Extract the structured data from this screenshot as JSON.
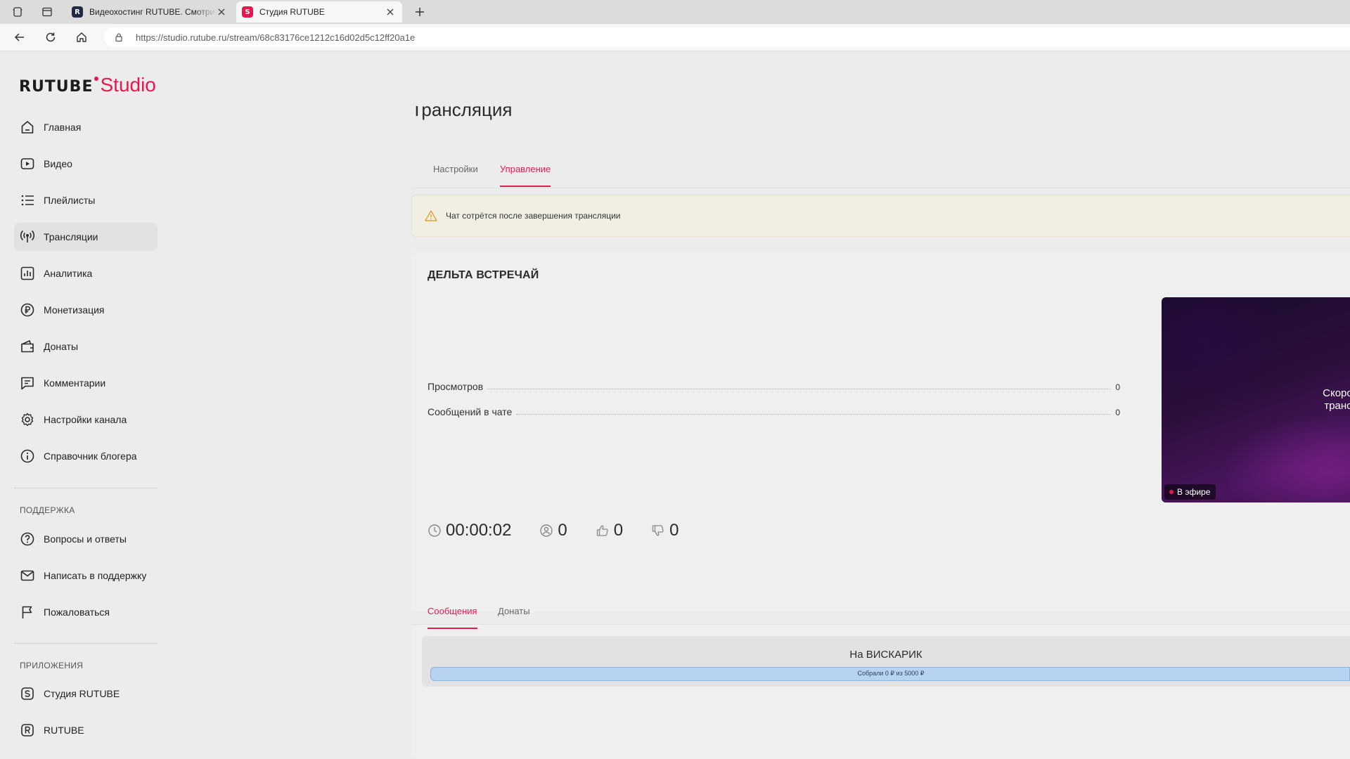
{
  "browser": {
    "tabs": [
      {
        "title": "Видеохостинг RUTUBE. Смотрите",
        "favicon": "rutube-icon",
        "color": "#1f2a44"
      },
      {
        "title": "Студия RUTUBE",
        "favicon": "studio-icon",
        "color": "#e5194e"
      }
    ],
    "url": "https://studio.rutube.ru/stream/68c83176ce1212c16d02d5c12ff20a1e"
  },
  "logo": {
    "brand": "RUTUBE",
    "product": "Studio"
  },
  "sidebar": {
    "items": [
      {
        "label": "Главная",
        "icon": "home-icon"
      },
      {
        "label": "Видео",
        "icon": "video-icon"
      },
      {
        "label": "Плейлисты",
        "icon": "list-icon"
      },
      {
        "label": "Трансляции",
        "icon": "broadcast-icon",
        "active": true
      },
      {
        "label": "Аналитика",
        "icon": "chart-icon"
      },
      {
        "label": "Монетизация",
        "icon": "ruble-icon"
      },
      {
        "label": "Донаты",
        "icon": "wallet-icon"
      },
      {
        "label": "Комментарии",
        "icon": "comment-icon"
      },
      {
        "label": "Настройки канала",
        "icon": "gear-icon"
      },
      {
        "label": "Справочник блогера",
        "icon": "info-icon"
      }
    ],
    "support_title": "ПОДДЕРЖКА",
    "support": [
      {
        "label": "Вопросы и ответы",
        "icon": "question-icon"
      },
      {
        "label": "Написать в поддержку",
        "icon": "mail-icon"
      },
      {
        "label": "Пожаловаться",
        "icon": "flag-icon"
      }
    ],
    "apps_title": "ПРИЛОЖЕНИЯ",
    "apps": [
      {
        "label": "Студия RUTUBE",
        "icon": "studio-app-icon"
      },
      {
        "label": "RUTUBE",
        "icon": "rutube-app-icon"
      }
    ]
  },
  "main": {
    "title": "Трансляция",
    "tabs": [
      {
        "label": "Настройки"
      },
      {
        "label": "Управление",
        "active": true
      }
    ],
    "alert": "Чат сотрётся после завершения трансляции",
    "stream": {
      "name": "ДЕЛЬТА ВСТРЕЧАЙ",
      "stats": [
        {
          "label": "Просмотров",
          "value": "0"
        },
        {
          "label": "Сообщений в чате",
          "value": "0"
        }
      ],
      "duration": "00:00:02",
      "viewers": "0",
      "likes": "0",
      "dislikes": "0",
      "preview_text_line1": "Скоро здесь",
      "preview_text_line2": "трансляция",
      "live_label": "В эфире"
    },
    "chat_tabs": [
      {
        "label": "Сообщения",
        "active": true
      },
      {
        "label": "Донаты"
      }
    ],
    "goal": {
      "title": "На ВИСКАРИК",
      "progress_text": "Собрали 0 ₽ из 5000 ₽",
      "progress_fraction": 0
    }
  },
  "colors": {
    "accent": "#e5194e",
    "progress": "#b8d3ef"
  }
}
